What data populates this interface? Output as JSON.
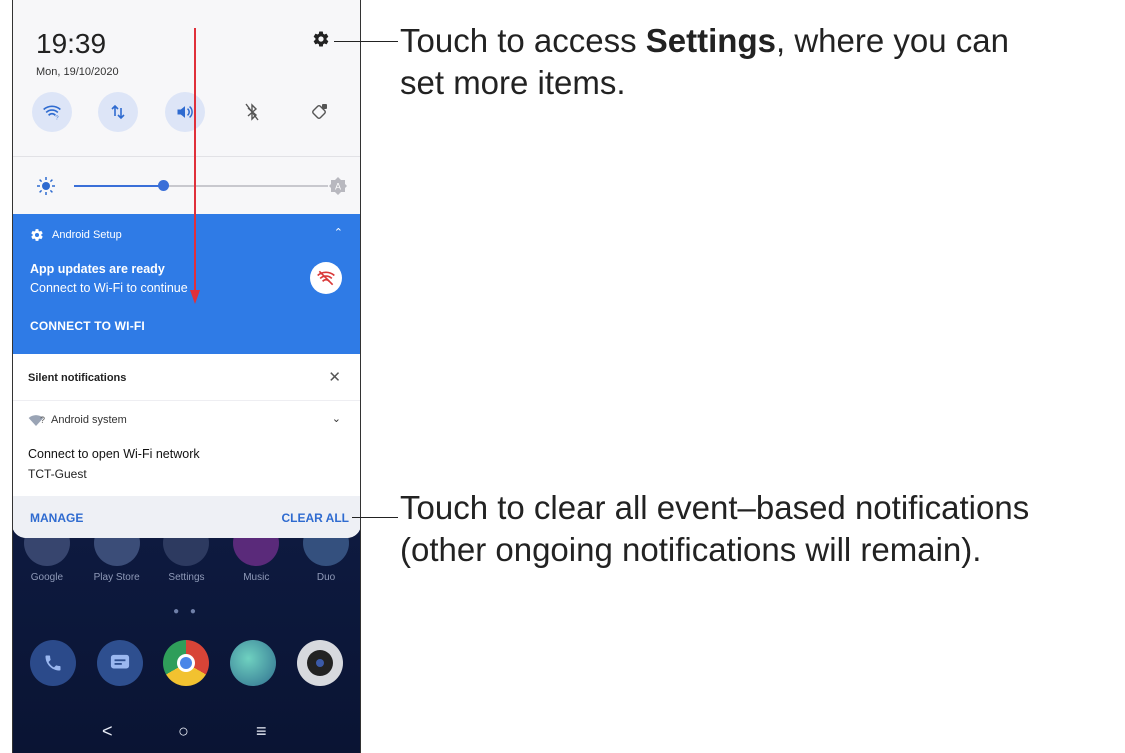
{
  "status": {
    "time": "19:39",
    "date": "Mon, 19/10/2020"
  },
  "quick_settings": {
    "tiles": [
      "wifi-icon",
      "mobile-data-icon",
      "sound-icon",
      "bluetooth-icon",
      "auto-rotate-icon"
    ],
    "brightness_level": 0.35,
    "auto_brightness_badge": "A"
  },
  "setup_notification": {
    "app": "Android Setup",
    "title": "App updates are ready",
    "text": "Connect to Wi-Fi to continue",
    "action": "CONNECT TO WI-FI"
  },
  "silent_section": {
    "header": "Silent notifications",
    "app": "Android system",
    "wifi_badge": "?",
    "title": "Connect to open Wi-Fi network",
    "text": "TCT-Guest"
  },
  "footer": {
    "manage": "MANAGE",
    "clear_all": "CLEAR ALL"
  },
  "home": {
    "apps": [
      "Google",
      "Play Store",
      "Settings",
      "Music",
      "Duo"
    ],
    "dock": [
      "phone-icon",
      "messages-icon",
      "chrome-icon",
      "gallery-icon",
      "camera-icon"
    ]
  },
  "navbar": {
    "back": "<",
    "home": "○",
    "recents": "≡"
  },
  "callouts": {
    "settings_prefix": "Touch to access ",
    "settings_bold": "Settings",
    "settings_suffix": ", where you can",
    "settings_line2": "set more items.",
    "clear_line1": "Touch to clear all event–based notifications",
    "clear_line2": "(other ongoing notifications will remain)."
  },
  "colors": {
    "accent_blue": "#2f7be6",
    "link_blue": "#2f6bd0",
    "arrow_red": "#e0303a"
  }
}
